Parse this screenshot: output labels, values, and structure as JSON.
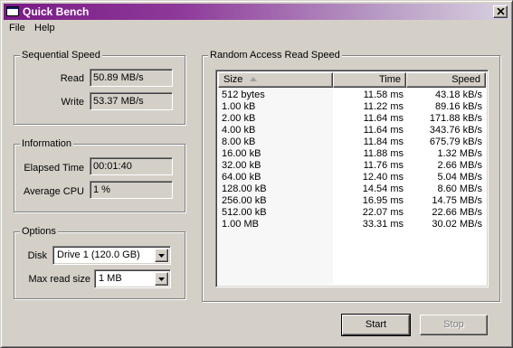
{
  "window": {
    "title": "Quick Bench"
  },
  "menu": {
    "file": "File",
    "help": "Help"
  },
  "sequential": {
    "title": "Sequential Speed",
    "read_label": "Read",
    "read_value": "50.89 MB/s",
    "write_label": "Write",
    "write_value": "53.37 MB/s"
  },
  "information": {
    "title": "Information",
    "elapsed_label": "Elapsed Time",
    "elapsed_value": "00:01:40",
    "cpu_label": "Average CPU",
    "cpu_value": "1 %"
  },
  "options": {
    "title": "Options",
    "disk_label": "Disk",
    "disk_value": "Drive 1 (120.0 GB)",
    "readsize_label": "Max read size",
    "readsize_value": "1 MB"
  },
  "random": {
    "title": "Random Access Read Speed",
    "columns": {
      "size": "Size",
      "time": "Time",
      "speed": "Speed"
    },
    "rows": [
      {
        "size": "512 bytes",
        "time": "11.58 ms",
        "speed": "43.18 kB/s"
      },
      {
        "size": "1.00 kB",
        "time": "11.22 ms",
        "speed": "89.16 kB/s"
      },
      {
        "size": "2.00 kB",
        "time": "11.64 ms",
        "speed": "171.88 kB/s"
      },
      {
        "size": "4.00 kB",
        "time": "11.64 ms",
        "speed": "343.76 kB/s"
      },
      {
        "size": "8.00 kB",
        "time": "11.84 ms",
        "speed": "675.79 kB/s"
      },
      {
        "size": "16.00 kB",
        "time": "11.88 ms",
        "speed": "1.32 MB/s"
      },
      {
        "size": "32.00 kB",
        "time": "11.76 ms",
        "speed": "2.66 MB/s"
      },
      {
        "size": "64.00 kB",
        "time": "12.40 ms",
        "speed": "5.04 MB/s"
      },
      {
        "size": "128.00 kB",
        "time": "14.54 ms",
        "speed": "8.60 MB/s"
      },
      {
        "size": "256.00 kB",
        "time": "16.95 ms",
        "speed": "14.75 MB/s"
      },
      {
        "size": "512.00 kB",
        "time": "22.07 ms",
        "speed": "22.66 MB/s"
      },
      {
        "size": "1.00 MB",
        "time": "33.31 ms",
        "speed": "30.02 MB/s"
      }
    ]
  },
  "buttons": {
    "start": "Start",
    "stop": "Stop"
  },
  "icons": {
    "app": "window-icon",
    "close": "close-icon",
    "sort": "sort-ascending-icon",
    "dropdown": "chevron-down-icon"
  }
}
